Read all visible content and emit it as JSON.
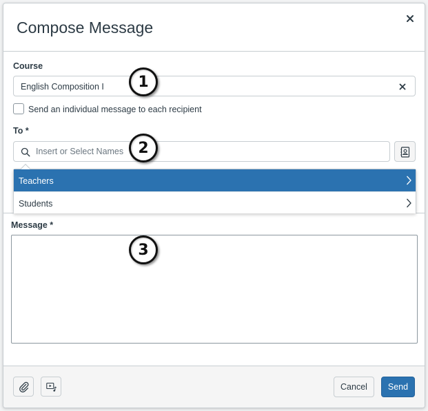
{
  "dialog": {
    "title": "Compose Message"
  },
  "course": {
    "label": "Course",
    "value": "English Composition I"
  },
  "individual_message": {
    "label": "Send an individual message to each recipient",
    "checked": false
  },
  "to": {
    "label": "To *",
    "placeholder": "Insert or Select Names"
  },
  "recipient_menu": {
    "items": [
      {
        "label": "Teachers",
        "highlighted": true
      },
      {
        "label": "Students",
        "highlighted": false
      }
    ]
  },
  "message": {
    "label": "Message *",
    "value": ""
  },
  "footer": {
    "cancel_label": "Cancel",
    "send_label": "Send"
  },
  "callouts": [
    "1",
    "2",
    "3"
  ],
  "icons": {
    "close": "close-icon",
    "clear": "clear-icon",
    "search": "search-icon",
    "address_book": "address-book-icon",
    "attachment": "paperclip-icon",
    "media": "media-icon",
    "chevron": "chevron-right-icon"
  },
  "colors": {
    "accent": "#2b72b0",
    "text": "#2d3b45",
    "border": "#c7cdd1",
    "footer_bg": "#f5f5f5"
  }
}
